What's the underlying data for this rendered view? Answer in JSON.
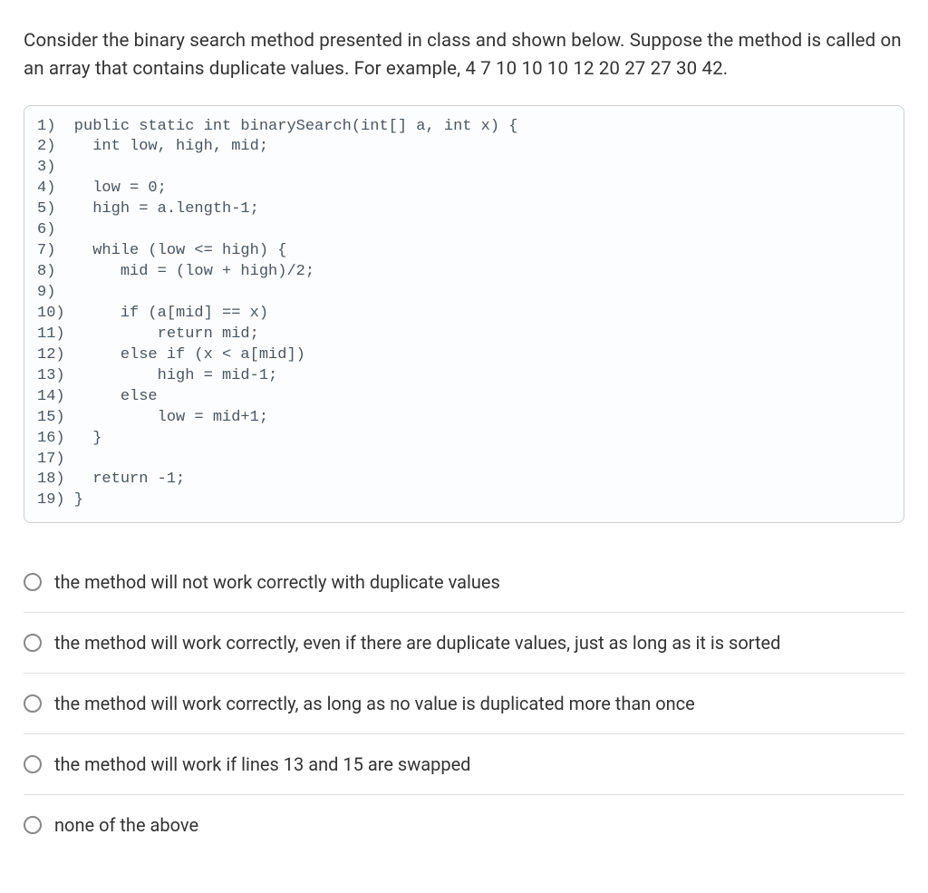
{
  "question": "Consider the binary search method presented in class and shown below. Suppose the method is called on an array that contains duplicate values. For example, 4  7  10  10  10  12  20  27  27  30  42.",
  "code": "1)  public static int binarySearch(int[] a, int x) {\n2)    int low, high, mid;\n3)\n4)    low = 0;\n5)    high = a.length-1;\n6)\n7)    while (low <= high) {\n8)       mid = (low + high)/2;\n9)\n10)      if (a[mid] == x)\n11)          return mid;\n12)      else if (x < a[mid])\n13)          high = mid-1;\n14)      else\n15)          low = mid+1;\n16)   }\n17)\n18)   return -1;\n19) }",
  "options": [
    {
      "label": "the method will not work correctly with duplicate values"
    },
    {
      "label": "the method will work correctly, even if there are duplicate values, just as long as it is sorted"
    },
    {
      "label": "the method will work correctly, as long as no value is duplicated more than once"
    },
    {
      "label": "the method will work if lines 13 and 15 are swapped"
    },
    {
      "label": "none of the above"
    }
  ]
}
